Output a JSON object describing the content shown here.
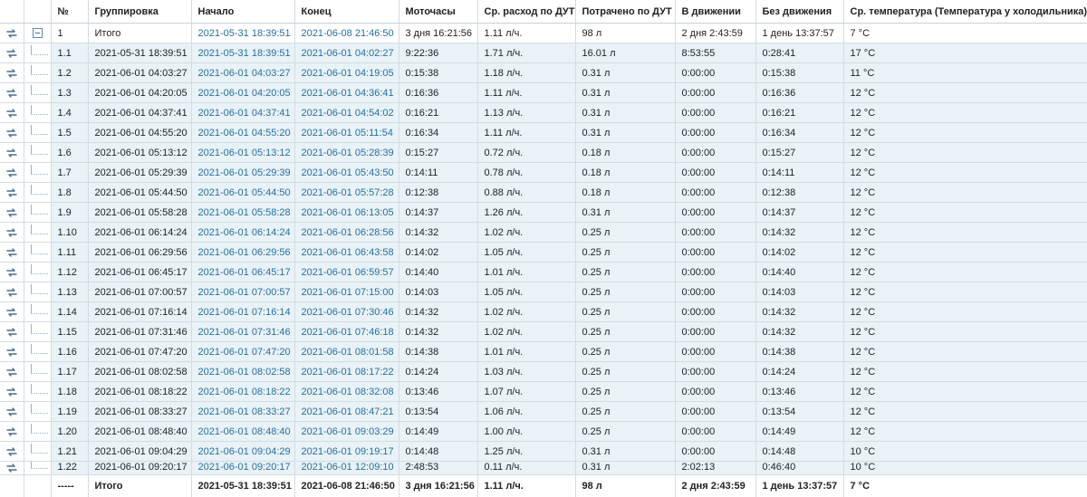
{
  "header": {
    "col_no": "№",
    "col_group": "Группировка",
    "col_start": "Начало",
    "col_end": "Конец",
    "col_motohours": "Моточасы",
    "col_avg_rate": "Ср. расход по ДУТ",
    "col_spent": "Потрачено по ДУТ",
    "col_moving": "В движении",
    "col_idle": "Без движения",
    "col_temp": "Ср. температура (Температура у холодильника)"
  },
  "total_row": {
    "no": "1",
    "group": "Итого",
    "start": "2021-05-31 18:39:51",
    "end": "2021-06-08 21:46:50",
    "motohours": "3 дня 16:21:56",
    "avg_rate": "1.11 л/ч.",
    "spent": "98 л",
    "moving": "2 дня 2:43:59",
    "idle": "1 день 13:37:57",
    "temp": "7 °C"
  },
  "rows": [
    {
      "no": "1.1",
      "group": "2021-05-31 18:39:51",
      "start": "2021-05-31 18:39:51",
      "end": "2021-06-01 04:02:27",
      "motohours": "9:22:36",
      "avg_rate": "1.71 л/ч.",
      "spent": "16.01 л",
      "moving": "8:53:55",
      "idle": "0:28:41",
      "temp": "17 °C"
    },
    {
      "no": "1.2",
      "group": "2021-06-01 04:03:27",
      "start": "2021-06-01 04:03:27",
      "end": "2021-06-01 04:19:05",
      "motohours": "0:15:38",
      "avg_rate": "1.18 л/ч.",
      "spent": "0.31 л",
      "moving": "0:00:00",
      "idle": "0:15:38",
      "temp": "11 °C"
    },
    {
      "no": "1.3",
      "group": "2021-06-01 04:20:05",
      "start": "2021-06-01 04:20:05",
      "end": "2021-06-01 04:36:41",
      "motohours": "0:16:36",
      "avg_rate": "1.11 л/ч.",
      "spent": "0.31 л",
      "moving": "0:00:00",
      "idle": "0:16:36",
      "temp": "12 °C"
    },
    {
      "no": "1.4",
      "group": "2021-06-01 04:37:41",
      "start": "2021-06-01 04:37:41",
      "end": "2021-06-01 04:54:02",
      "motohours": "0:16:21",
      "avg_rate": "1.13 л/ч.",
      "spent": "0.31 л",
      "moving": "0:00:00",
      "idle": "0:16:21",
      "temp": "12 °C"
    },
    {
      "no": "1.5",
      "group": "2021-06-01 04:55:20",
      "start": "2021-06-01 04:55:20",
      "end": "2021-06-01 05:11:54",
      "motohours": "0:16:34",
      "avg_rate": "1.11 л/ч.",
      "spent": "0.31 л",
      "moving": "0:00:00",
      "idle": "0:16:34",
      "temp": "12 °C"
    },
    {
      "no": "1.6",
      "group": "2021-06-01 05:13:12",
      "start": "2021-06-01 05:13:12",
      "end": "2021-06-01 05:28:39",
      "motohours": "0:15:27",
      "avg_rate": "0.72 л/ч.",
      "spent": "0.18 л",
      "moving": "0:00:00",
      "idle": "0:15:27",
      "temp": "12 °C"
    },
    {
      "no": "1.7",
      "group": "2021-06-01 05:29:39",
      "start": "2021-06-01 05:29:39",
      "end": "2021-06-01 05:43:50",
      "motohours": "0:14:11",
      "avg_rate": "0.78 л/ч.",
      "spent": "0.18 л",
      "moving": "0:00:00",
      "idle": "0:14:11",
      "temp": "12 °C"
    },
    {
      "no": "1.8",
      "group": "2021-06-01 05:44:50",
      "start": "2021-06-01 05:44:50",
      "end": "2021-06-01 05:57:28",
      "motohours": "0:12:38",
      "avg_rate": "0.88 л/ч.",
      "spent": "0.18 л",
      "moving": "0:00:00",
      "idle": "0:12:38",
      "temp": "12 °C"
    },
    {
      "no": "1.9",
      "group": "2021-06-01 05:58:28",
      "start": "2021-06-01 05:58:28",
      "end": "2021-06-01 06:13:05",
      "motohours": "0:14:37",
      "avg_rate": "1.26 л/ч.",
      "spent": "0.31 л",
      "moving": "0:00:00",
      "idle": "0:14:37",
      "temp": "12 °C"
    },
    {
      "no": "1.10",
      "group": "2021-06-01 06:14:24",
      "start": "2021-06-01 06:14:24",
      "end": "2021-06-01 06:28:56",
      "motohours": "0:14:32",
      "avg_rate": "1.02 л/ч.",
      "spent": "0.25 л",
      "moving": "0:00:00",
      "idle": "0:14:32",
      "temp": "12 °C"
    },
    {
      "no": "1.11",
      "group": "2021-06-01 06:29:56",
      "start": "2021-06-01 06:29:56",
      "end": "2021-06-01 06:43:58",
      "motohours": "0:14:02",
      "avg_rate": "1.05 л/ч.",
      "spent": "0.25 л",
      "moving": "0:00:00",
      "idle": "0:14:02",
      "temp": "12 °C"
    },
    {
      "no": "1.12",
      "group": "2021-06-01 06:45:17",
      "start": "2021-06-01 06:45:17",
      "end": "2021-06-01 06:59:57",
      "motohours": "0:14:40",
      "avg_rate": "1.01 л/ч.",
      "spent": "0.25 л",
      "moving": "0:00:00",
      "idle": "0:14:40",
      "temp": "12 °C"
    },
    {
      "no": "1.13",
      "group": "2021-06-01 07:00:57",
      "start": "2021-06-01 07:00:57",
      "end": "2021-06-01 07:15:00",
      "motohours": "0:14:03",
      "avg_rate": "1.05 л/ч.",
      "spent": "0.25 л",
      "moving": "0:00:00",
      "idle": "0:14:03",
      "temp": "12 °C"
    },
    {
      "no": "1.14",
      "group": "2021-06-01 07:16:14",
      "start": "2021-06-01 07:16:14",
      "end": "2021-06-01 07:30:46",
      "motohours": "0:14:32",
      "avg_rate": "1.02 л/ч.",
      "spent": "0.25 л",
      "moving": "0:00:00",
      "idle": "0:14:32",
      "temp": "12 °C"
    },
    {
      "no": "1.15",
      "group": "2021-06-01 07:31:46",
      "start": "2021-06-01 07:31:46",
      "end": "2021-06-01 07:46:18",
      "motohours": "0:14:32",
      "avg_rate": "1.02 л/ч.",
      "spent": "0.25 л",
      "moving": "0:00:00",
      "idle": "0:14:32",
      "temp": "12 °C"
    },
    {
      "no": "1.16",
      "group": "2021-06-01 07:47:20",
      "start": "2021-06-01 07:47:20",
      "end": "2021-06-01 08:01:58",
      "motohours": "0:14:38",
      "avg_rate": "1.01 л/ч.",
      "spent": "0.25 л",
      "moving": "0:00:00",
      "idle": "0:14:38",
      "temp": "12 °C"
    },
    {
      "no": "1.17",
      "group": "2021-06-01 08:02:58",
      "start": "2021-06-01 08:02:58",
      "end": "2021-06-01 08:17:22",
      "motohours": "0:14:24",
      "avg_rate": "1.03 л/ч.",
      "spent": "0.25 л",
      "moving": "0:00:00",
      "idle": "0:14:24",
      "temp": "12 °C"
    },
    {
      "no": "1.18",
      "group": "2021-06-01 08:18:22",
      "start": "2021-06-01 08:18:22",
      "end": "2021-06-01 08:32:08",
      "motohours": "0:13:46",
      "avg_rate": "1.07 л/ч.",
      "spent": "0.25 л",
      "moving": "0:00:00",
      "idle": "0:13:46",
      "temp": "12 °C"
    },
    {
      "no": "1.19",
      "group": "2021-06-01 08:33:27",
      "start": "2021-06-01 08:33:27",
      "end": "2021-06-01 08:47:21",
      "motohours": "0:13:54",
      "avg_rate": "1.06 л/ч.",
      "spent": "0.25 л",
      "moving": "0:00:00",
      "idle": "0:13:54",
      "temp": "12 °C"
    },
    {
      "no": "1.20",
      "group": "2021-06-01 08:48:40",
      "start": "2021-06-01 08:48:40",
      "end": "2021-06-01 09:03:29",
      "motohours": "0:14:49",
      "avg_rate": "1.00 л/ч.",
      "spent": "0.25 л",
      "moving": "0:00:00",
      "idle": "0:14:49",
      "temp": "12 °C"
    },
    {
      "no": "1.21",
      "group": "2021-06-01 09:04:29",
      "start": "2021-06-01 09:04:29",
      "end": "2021-06-01 09:19:17",
      "motohours": "0:14:48",
      "avg_rate": "1.25 л/ч.",
      "spent": "0.31 л",
      "moving": "0:00:00",
      "idle": "0:14:48",
      "temp": "10 °C"
    },
    {
      "no": "1.22",
      "group": "2021-06-01 09:20:17",
      "start": "2021-06-01 09:20:17",
      "end": "2021-06-01 12:09:10",
      "motohours": "2:48:53",
      "avg_rate": "0.11 л/ч.",
      "spent": "0.31 л",
      "moving": "2:02:13",
      "idle": "0:46:40",
      "temp": "10 °C"
    }
  ],
  "footer": {
    "no": "-----",
    "group": "Итого",
    "start": "2021-05-31 18:39:51",
    "end": "2021-06-08 21:46:50",
    "motohours": "3 дня 16:21:56",
    "avg_rate": "1.11 л/ч.",
    "spent": "98 л",
    "moving": "2 дня 2:43:59",
    "idle": "1 день 13:37:57",
    "temp": "7 °C"
  },
  "icons": {
    "row_action": "sync-arrows-icon",
    "collapse": "collapse-minus-icon",
    "tree": "tree-connector-icon"
  },
  "colors": {
    "row_bg": "#e8f2f7",
    "link": "#2a6e9e",
    "border": "#d3dce3"
  }
}
